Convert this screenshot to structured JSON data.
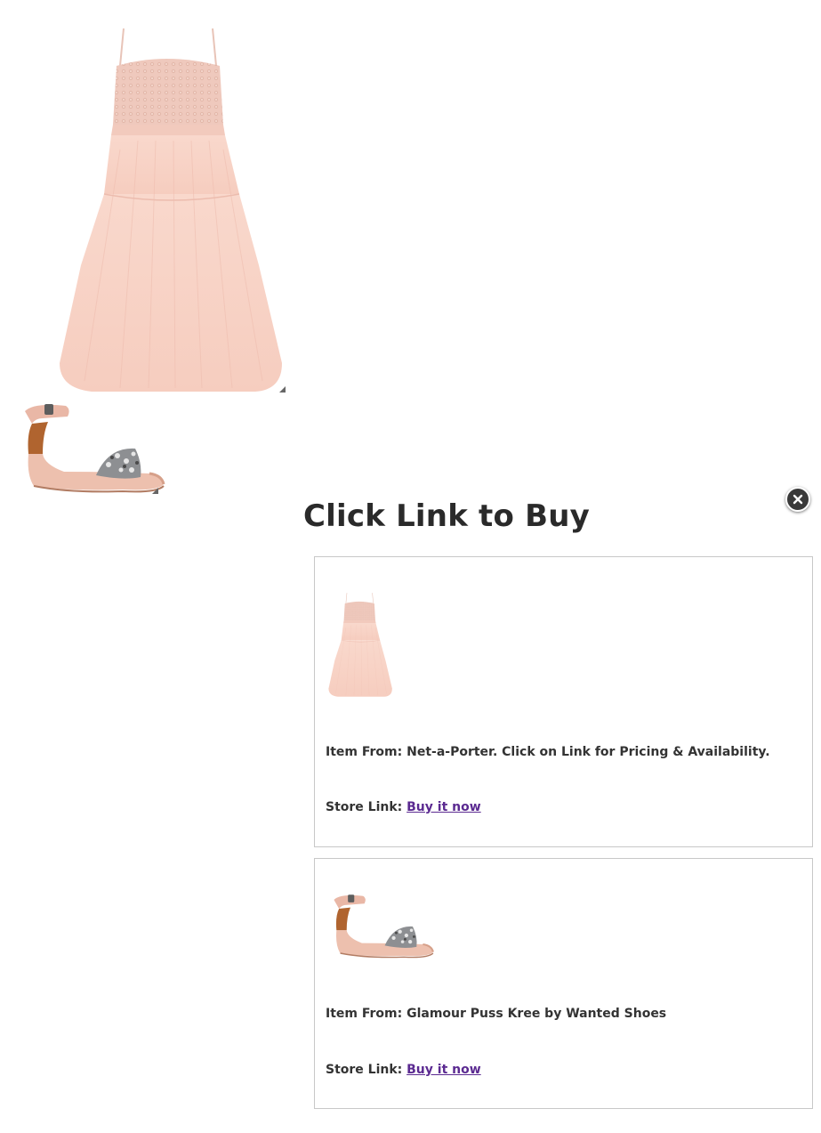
{
  "outfit": {
    "dress_image": "pink-tulle-dress",
    "sandal_image": "embellished-ankle-strap-sandal"
  },
  "modal": {
    "title": "Click Link to Buy",
    "close_icon": "close-icon",
    "items": [
      {
        "image": "pink-tulle-dress",
        "item_from": "Item From: Net-a-Porter. Click on Link for Pricing & Availability.",
        "store_label": "Store Link:",
        "link_text": "Buy it now"
      },
      {
        "image": "embellished-ankle-strap-sandal",
        "item_from": "Item From: Glamour Puss Kree by Wanted Shoes",
        "store_label": "Store Link:",
        "link_text": "Buy it now"
      }
    ]
  },
  "colors": {
    "link": "#5b2a91",
    "dress": "#f7d3c8",
    "close_button": "#3a3a3a"
  }
}
